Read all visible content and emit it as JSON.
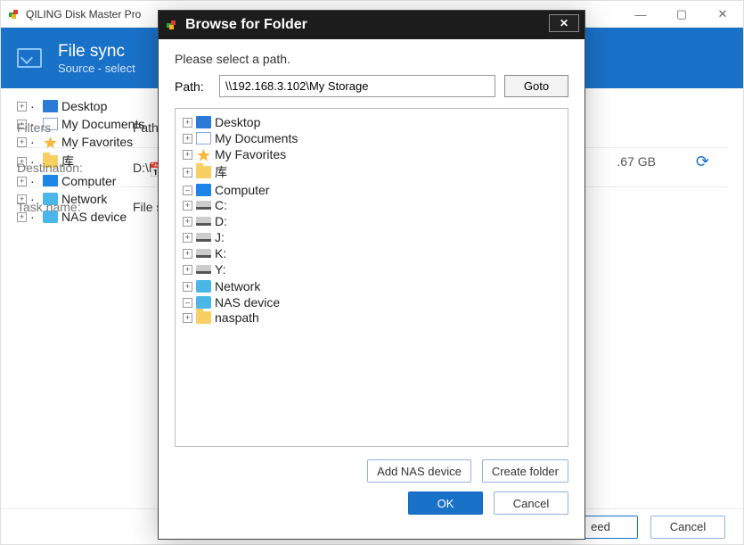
{
  "mainWindow": {
    "title": "QILING Disk Master Pro",
    "header": {
      "title": "File sync",
      "subtitle": "Source - select"
    },
    "tree": [
      {
        "icon": "desktop",
        "label": "Desktop"
      },
      {
        "icon": "doc",
        "label": "My Documents"
      },
      {
        "icon": "star",
        "label": "My Favorites"
      },
      {
        "icon": "folder",
        "label": "库"
      },
      {
        "icon": "computer",
        "label": "Computer"
      },
      {
        "icon": "net",
        "label": "Network"
      },
      {
        "icon": "nas",
        "label": "NAS device"
      }
    ],
    "filters": {
      "label": "Filters",
      "pathLabel": "Path:"
    },
    "destination": {
      "label": "Destination:",
      "value": "D:\\My"
    },
    "taskName": {
      "label": "Task name:",
      "value": "File sy"
    },
    "freeSpace": ".67 GB",
    "footer": {
      "proceed": "eed",
      "cancel": "Cancel"
    }
  },
  "dialog": {
    "title": "Browse for Folder",
    "prompt": "Please select a path.",
    "pathLabel": "Path:",
    "pathValue": "\\\\192.168.3.102\\My Storage",
    "goto": "Goto",
    "tree": {
      "desktop": "Desktop",
      "myDocs": "My Documents",
      "myFav": "My Favorites",
      "ku": "库",
      "computer": "Computer",
      "drives": [
        "C:",
        "D:",
        "J:",
        "K:",
        "Y:"
      ],
      "network": "Network",
      "nas": "NAS device",
      "naspath": "naspath"
    },
    "buttons": {
      "addNas": "Add NAS device",
      "createFolder": "Create folder",
      "ok": "OK",
      "cancel": "Cancel"
    }
  }
}
